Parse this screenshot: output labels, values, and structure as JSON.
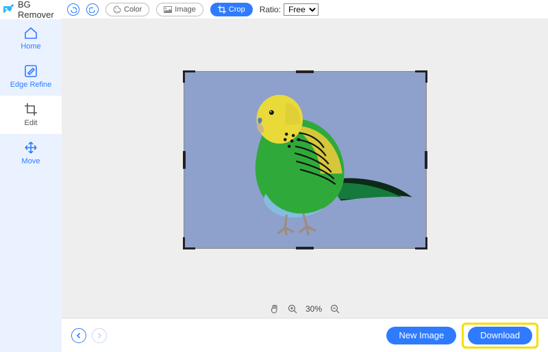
{
  "app": {
    "title": "BG Remover"
  },
  "sidebar": {
    "home": "Home",
    "edgeRefine": "Edge Refine",
    "edit": "Edit",
    "move": "Move"
  },
  "toolbar": {
    "color": "Color",
    "image": "Image",
    "crop": "Crop",
    "ratioLabel": "Ratio:",
    "ratioValue": "Free",
    "ratioOptions": [
      "Free"
    ]
  },
  "zoom": {
    "value": "30%"
  },
  "footer": {
    "newImage": "New Image",
    "download": "Download"
  },
  "colors": {
    "accent": "#2f7bff",
    "highlight": "#f2e000",
    "canvasBg": "#8ea0cc"
  }
}
